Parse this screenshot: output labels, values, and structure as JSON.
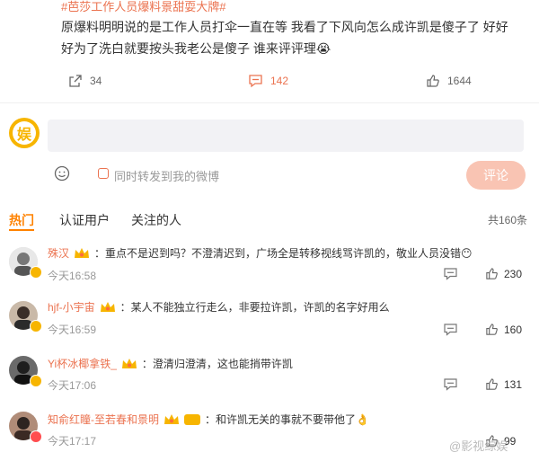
{
  "post": {
    "topic": "#芭莎工作人员爆料景甜耍大牌#",
    "text": "原爆料明明说的是工作人员打伞一直在等 我看了下风向怎么成许凯是傻子了 好好好为了洗白就要按头我老公是傻子 谁来评评理😭",
    "reposts": "34",
    "comments": "142",
    "likes": "1644"
  },
  "composer": {
    "avatar_char": "娱",
    "placeholder": "",
    "repost_label": "同时转发到我的微博",
    "submit_label": "评论"
  },
  "tabs": {
    "items": [
      "热门",
      "认证用户",
      "关注的人"
    ],
    "total": "共160条"
  },
  "comments": [
    {
      "name": "殊汉",
      "text": "：重点不是迟到吗？不澄清迟到，广场全是转移视线骂许凯的，敬业人员没错😶",
      "time": "今天16:58",
      "likes": "230",
      "badge": "gold"
    },
    {
      "name": "hjf-小宇宙",
      "text": "：某人不能独立行走么，非要拉许凯，许凯的名字好用么",
      "time": "今天16:59",
      "likes": "160",
      "badge": "gold"
    },
    {
      "name": "Yi杯冰椰拿铁_",
      "text": "：澄清归澄清，这也能捎带许凯",
      "time": "今天17:06",
      "likes": "131",
      "badge": "gold"
    },
    {
      "name": "知俞红瞳-至若春和景明",
      "text": "：和许凯无关的事就不要带他了👌",
      "time": "今天17:17",
      "likes": "99",
      "badge": "red"
    }
  ],
  "watermark": "@影视综娱",
  "colors": {
    "accent": "#ff8200",
    "name": "#eb7350",
    "submit": "#f9c4b3"
  }
}
